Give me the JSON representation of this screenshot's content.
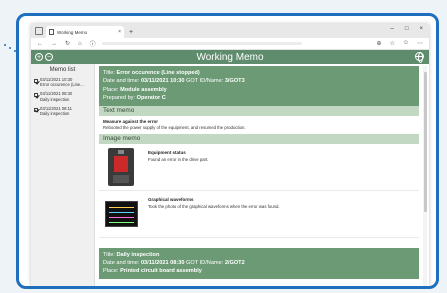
{
  "browser": {
    "tab_title": "Working Memo",
    "tab_close": "×",
    "new_tab": "+",
    "window_controls": [
      "–",
      "□",
      "×"
    ],
    "nav_icons": [
      "←",
      "→",
      "↻",
      "⌂",
      "ⓘ"
    ],
    "right_icons": [
      "⊕",
      "☆",
      "☺",
      "⋯"
    ]
  },
  "app": {
    "title": "Working Memo",
    "add_icon": "+",
    "remove_icon": "−"
  },
  "sidebar": {
    "heading": "Memo list",
    "items": [
      {
        "line1": "03/11/2021 10:30",
        "line2": "Error occurence (Line..."
      },
      {
        "line1": "03/11/2021 08:30",
        "line2": "Daily inspection"
      },
      {
        "line1": "03/11/2021 08:11",
        "line2": "Daily inspection"
      }
    ]
  },
  "record1": {
    "title_label": "Title: ",
    "title_value": "Error occurence (Line stopped)",
    "datetime_label": "Date and time: ",
    "datetime_value": "03/11/2021 10:30",
    "gotid_label": " GOT ID/Name: ",
    "gotid_value": "3/GOT3",
    "place_label": "Place: ",
    "place_value": "Module assembly",
    "prepared_label": "Prepared by: ",
    "prepared_value": "Operator C",
    "text_memo_heading": "Text memo",
    "text_memo_title": "Measure against the error",
    "text_memo_body": "Rebooted the power supply of the equipment, and resumed the production.",
    "image_memo_heading": "Image memo",
    "images": [
      {
        "title": "Equipment status",
        "body": "Found an error in the drive part."
      },
      {
        "title": "Graphical waveforms",
        "body": "Took the photo of the graphical waveforms when the error was found."
      }
    ]
  },
  "record2": {
    "title_label": "Title: ",
    "title_value": "Daily inspection",
    "datetime_label": "Date and time: ",
    "datetime_value": "03/11/2021 08:30",
    "gotid_label": " GOT ID/Name: ",
    "gotid_value": "2/GOT2",
    "place_label": "Place: ",
    "place_value": "Printed circuit board assembly"
  },
  "colors": {
    "accent_border": "#1f6fbf",
    "header_green": "#5e8c6c",
    "record_green": "#6b9a74",
    "section_green": "#c3d8c2"
  }
}
